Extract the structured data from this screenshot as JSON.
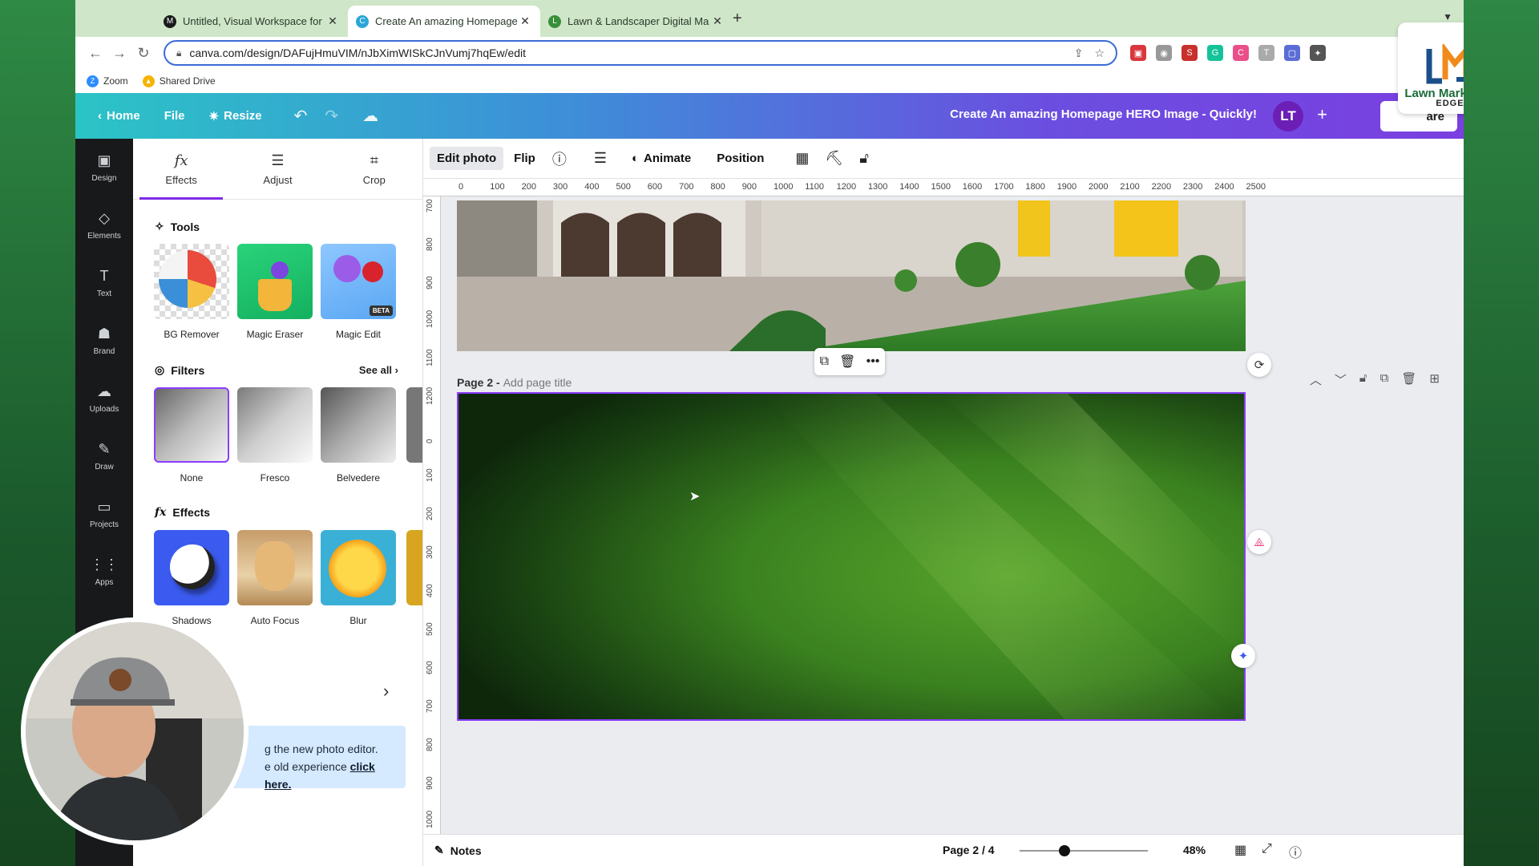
{
  "browser": {
    "tabs": [
      {
        "title": "Untitled, Visual Workspace for",
        "favicon_color": "#1a1a1a",
        "favicon_glyph": "M"
      },
      {
        "title": "Create An amazing Homepage",
        "favicon_color": "#2aa6d8",
        "favicon_glyph": "C"
      },
      {
        "title": "Lawn & Landscaper Digital Ma",
        "favicon_color": "#3a8f3a",
        "favicon_glyph": "L"
      }
    ],
    "url": "canva.com/design/DAFujHmuVIM/nJbXimWISkCJnVumj7hqEw/edit",
    "bookmarks": [
      {
        "label": "Zoom",
        "color": "#2d8cff",
        "glyph": "Z"
      },
      {
        "label": "Shared Drive",
        "color": "#f4b400",
        "glyph": "▲"
      }
    ]
  },
  "header": {
    "home": "Home",
    "file": "File",
    "resize": "Resize",
    "title": "Create An amazing Homepage HERO Image - Quickly!",
    "avatar_initials": "LT",
    "share": "are"
  },
  "logo": {
    "line1": "Lawn Marketing",
    "line2": "EDGE"
  },
  "rail": [
    {
      "label": "Design",
      "icon": "▣"
    },
    {
      "label": "Elements",
      "icon": "◇"
    },
    {
      "label": "Text",
      "icon": "T"
    },
    {
      "label": "Brand",
      "icon": "☗"
    },
    {
      "label": "Uploads",
      "icon": "☁"
    },
    {
      "label": "Draw",
      "icon": "✎"
    },
    {
      "label": "Projects",
      "icon": "▭"
    },
    {
      "label": "Apps",
      "icon": "⋮⋮"
    }
  ],
  "panel": {
    "tabs": [
      {
        "label": "Effects",
        "icon": "fx"
      },
      {
        "label": "Adjust",
        "icon": "☰"
      },
      {
        "label": "Crop",
        "icon": "⌗"
      }
    ],
    "tools_heading": "Tools",
    "tools": [
      {
        "label": "BG Remover"
      },
      {
        "label": "Magic Eraser"
      },
      {
        "label": "Magic Edit",
        "badge": "BETA"
      }
    ],
    "filters_heading": "Filters",
    "see_all": "See all",
    "filters": [
      {
        "label": "None"
      },
      {
        "label": "Fresco"
      },
      {
        "label": "Belvedere"
      }
    ],
    "effects_heading": "Effects",
    "effects": [
      {
        "label": "Shadows"
      },
      {
        "label": "Auto Focus"
      },
      {
        "label": "Blur"
      }
    ],
    "notice_line1": "g the new photo editor.",
    "notice_line2": "e old experience",
    "notice_link": "click here."
  },
  "context_toolbar": {
    "edit_photo": "Edit photo",
    "flip": "Flip",
    "animate": "Animate",
    "position": "Position"
  },
  "ruler": {
    "h_ticks": [
      "0",
      "100",
      "200",
      "300",
      "400",
      "500",
      "600",
      "700",
      "800",
      "900",
      "1000",
      "1100",
      "1200",
      "1300",
      "1400",
      "1500",
      "1600",
      "1700",
      "1800",
      "1900",
      "2000",
      "2100",
      "2200",
      "2300",
      "2400",
      "2500"
    ],
    "v_ticks": [
      "700",
      "800",
      "900",
      "1000",
      "1100",
      "1200",
      "0",
      "100",
      "200",
      "300",
      "400",
      "500",
      "600",
      "700",
      "800",
      "900",
      "1000"
    ]
  },
  "canvas": {
    "page_label": "Page 2 -",
    "page_title_placeholder": "Add page title"
  },
  "bottom": {
    "notes": "Notes",
    "page_counter": "Page 2 / 4",
    "zoom": "48%",
    "zoom_fraction": 0.35
  }
}
